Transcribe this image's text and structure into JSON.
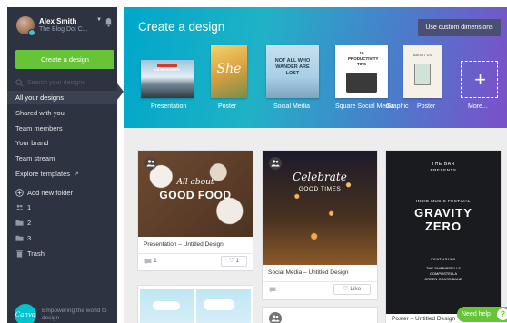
{
  "profile": {
    "name": "Alex Smith",
    "team": "The Blog Dot C..."
  },
  "sidebar": {
    "create_label": "Create a design",
    "search_placeholder": "Search your designs",
    "nav": [
      {
        "label": "All your designs",
        "active": true
      },
      {
        "label": "Shared with you",
        "active": false
      },
      {
        "label": "Team members",
        "active": false
      },
      {
        "label": "Your brand",
        "active": false
      },
      {
        "label": "Team stream",
        "active": false
      },
      {
        "label": "Explore templates",
        "active": false
      }
    ],
    "add_folder_label": "Add new folder",
    "folders": [
      "1",
      "2",
      "3"
    ],
    "trash_label": "Trash",
    "footer_logo": "Canva",
    "footer_text": "Empowering the world to design"
  },
  "banner": {
    "title": "Create a design",
    "custom_dimensions_label": "Use custom dimensions",
    "templates": [
      {
        "label": "Presentation",
        "thumb_text": "KILIMANJARO"
      },
      {
        "label": "Poster",
        "thumb_text": "She"
      },
      {
        "label": "Social Media",
        "thumb_text": "NOT ALL WHO WANDER ARE LOST"
      },
      {
        "label": "Square Social Media",
        "thumb_text": "10 PRODUCTIVITY TIPS"
      },
      {
        "label": "Graphic",
        "thumb_text": "ABOUT US"
      },
      {
        "label": "Poster",
        "thumb_text": ""
      },
      {
        "label": "More...",
        "thumb_text": ""
      }
    ]
  },
  "designs": [
    {
      "caption": "Presentation – Untitled Design",
      "thumb_title_top": "All about",
      "thumb_title_main": "GOOD FOOD",
      "comments": "1",
      "likes": "1"
    },
    {
      "caption": "Social Media – Untitled Design",
      "thumb_title_top": "Celebrate",
      "thumb_title_main": "GOOD TIMES",
      "like_label": "Like"
    },
    {
      "caption": "Poster – Untitled Design",
      "bar": "THE BAR",
      "presents": "PRESENTS",
      "festival": "INDIE MUSIC FESTIVAL",
      "headline_1": "GRAVITY",
      "headline_2": "ZERO",
      "featuring": "FEATURING",
      "lineup": "THE SHIMMERELLS\nCOMPOSTELLA\nGREEN GRASS BAND"
    }
  ],
  "help": {
    "label": "Need help",
    "icon_text": "?"
  },
  "colors": {
    "sidebar_bg": "#2d3340",
    "accent_green": "#66c437",
    "canva_teal": "#00c4cc"
  }
}
